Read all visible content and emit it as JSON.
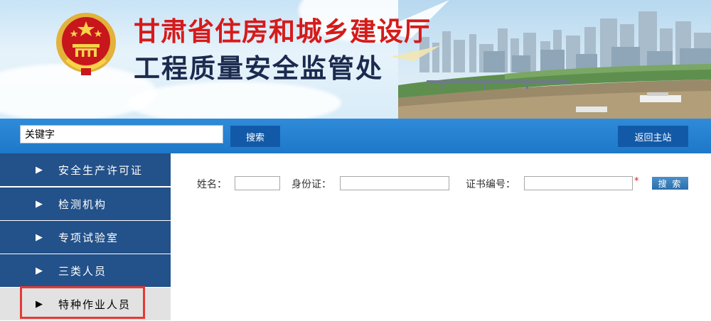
{
  "header": {
    "title_main": "甘肃省住房和城乡建设厅",
    "title_sub": "工程质量安全监管处",
    "colors": {
      "title_main": "#d61a1a",
      "title_sub": "#1b2a4e"
    }
  },
  "searchbar": {
    "keyword_value": "关键字",
    "search_label": "搜索",
    "home_label": "返回主站",
    "colors": {
      "bar": "#1e78c9",
      "button": "#125aa8"
    }
  },
  "sidebar": {
    "items": [
      {
        "label": "安全生产许可证",
        "active": false
      },
      {
        "label": "检测机构",
        "active": false
      },
      {
        "label": "专项试验室",
        "active": false
      },
      {
        "label": "三类人员",
        "active": false
      },
      {
        "label": "特种作业人员",
        "active": true
      }
    ],
    "arrow_icon": "play-triangle-icon",
    "colors": {
      "item": "#235189",
      "active": "#e2e2e2",
      "highlight": "#e53935"
    }
  },
  "form": {
    "name_label": "姓名：",
    "name_value": "",
    "id_label": "身份证：",
    "id_value": "",
    "cert_label": "证书编号：",
    "cert_value": "",
    "required_mark": "*",
    "search_label": "搜 索"
  }
}
